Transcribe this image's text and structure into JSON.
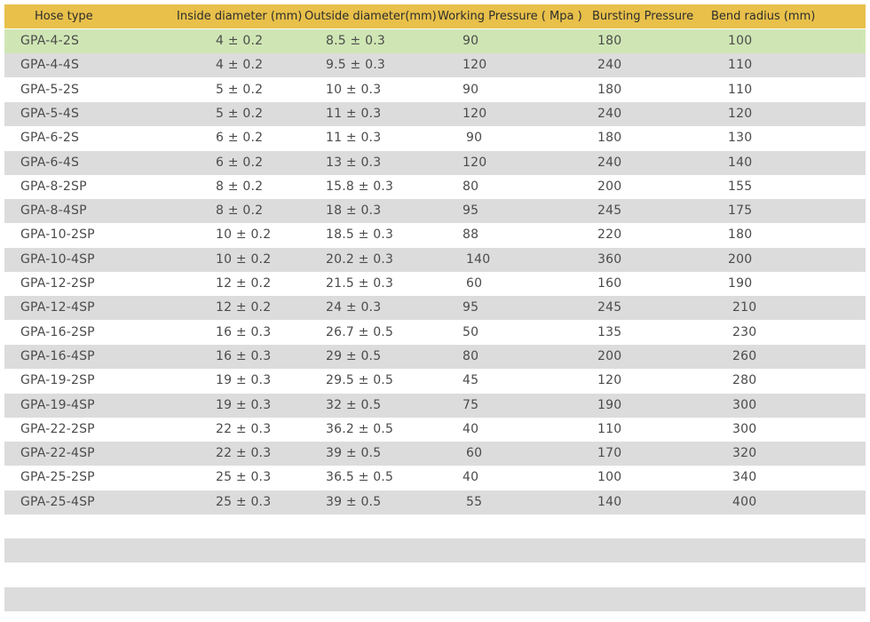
{
  "table": {
    "headers": [
      "Hose type",
      "Inside diameter (mm)",
      "Outside diameter(mm)",
      "Working Pressure ( Mpa )",
      "Bursting Pressure",
      "Bend radius (mm)"
    ],
    "rows": [
      [
        "GPA-4-2S",
        "4 ± 0.2",
        "8.5 ± 0.3",
        "90",
        "180",
        "100"
      ],
      [
        "GPA-4-4S",
        "4 ± 0.2",
        "9.5 ± 0.3",
        "120",
        "240",
        "110"
      ],
      [
        "GPA-5-2S",
        "5 ± 0.2",
        "10 ± 0.3",
        "90",
        "180",
        "110"
      ],
      [
        "GPA-5-4S",
        "5 ± 0.2",
        "11 ± 0.3",
        "120",
        "240",
        "120"
      ],
      [
        "GPA-6-2S",
        "6 ± 0.2",
        "11 ± 0.3",
        "90",
        "180",
        "130"
      ],
      [
        "GPA-6-4S",
        "6 ± 0.2",
        "13 ± 0.3",
        "120",
        "240",
        "140"
      ],
      [
        "GPA-8-2SP",
        "8 ± 0.2",
        "15.8 ± 0.3",
        "80",
        "200",
        "155"
      ],
      [
        "GPA-8-4SP",
        "8 ± 0.2",
        "18 ± 0.3",
        "95",
        "245",
        "175"
      ],
      [
        "GPA-10-2SP",
        "10 ± 0.2",
        "18.5 ± 0.3",
        "88",
        "220",
        "180"
      ],
      [
        "GPA-10-4SP",
        "10 ± 0.2",
        "20.2 ± 0.3",
        "140",
        "360",
        "200"
      ],
      [
        "GPA-12-2SP",
        "12 ± 0.2",
        "21.5 ± 0.3",
        "60",
        "160",
        "190"
      ],
      [
        "GPA-12-4SP",
        "12 ± 0.2",
        "24 ± 0.3",
        "95",
        "245",
        "210"
      ],
      [
        "GPA-16-2SP",
        "16 ± 0.3",
        "26.7 ± 0.5",
        "50",
        "135",
        "230"
      ],
      [
        "GPA-16-4SP",
        "16 ± 0.3",
        "29 ± 0.5",
        "80",
        "200",
        "260"
      ],
      [
        "GPA-19-2SP",
        "19 ± 0.3",
        "29.5 ± 0.5",
        "45",
        "120",
        "280"
      ],
      [
        "GPA-19-4SP",
        "19 ± 0.3",
        "32 ± 0.5",
        "75",
        "190",
        "300"
      ],
      [
        "GPA-22-2SP",
        "22 ± 0.3",
        "36.2 ± 0.5",
        "40",
        "110",
        "300"
      ],
      [
        "GPA-22-4SP",
        "22 ± 0.3",
        "39 ± 0.5",
        "60",
        "170",
        "320"
      ],
      [
        "GPA-25-2SP",
        "25 ± 0.3",
        "36.5 ± 0.5",
        "40",
        "100",
        "340"
      ],
      [
        "GPA-25-4SP",
        "25 ± 0.3",
        "39 ± 0.5",
        "55",
        "140",
        "400"
      ]
    ]
  },
  "colors": {
    "header_bg": "#e8c04a",
    "highlight_row_bg": "#cfe6b4",
    "stripe_bg": "#dcdcdc"
  }
}
